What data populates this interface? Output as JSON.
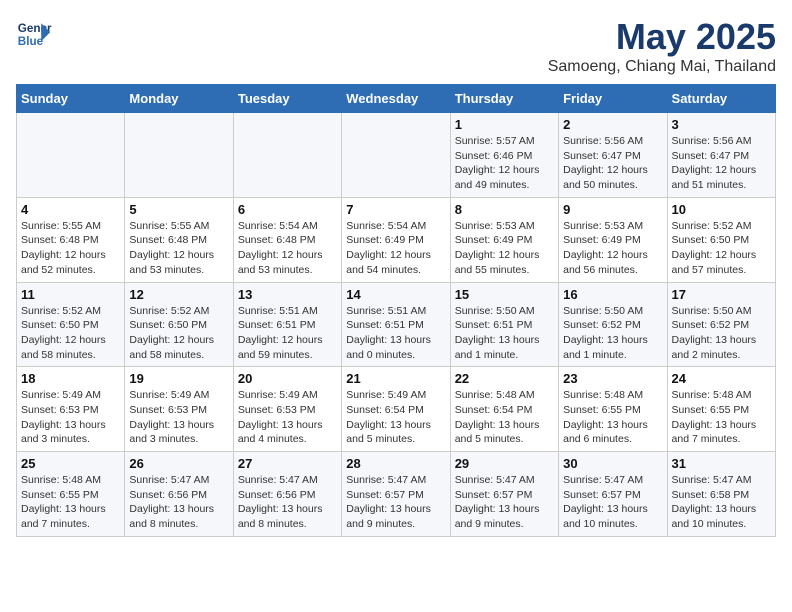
{
  "header": {
    "logo_line1": "General",
    "logo_line2": "Blue",
    "title": "May 2025",
    "subtitle": "Samoeng, Chiang Mai, Thailand"
  },
  "weekdays": [
    "Sunday",
    "Monday",
    "Tuesday",
    "Wednesday",
    "Thursday",
    "Friday",
    "Saturday"
  ],
  "weeks": [
    [
      {
        "day": "",
        "info": ""
      },
      {
        "day": "",
        "info": ""
      },
      {
        "day": "",
        "info": ""
      },
      {
        "day": "",
        "info": ""
      },
      {
        "day": "1",
        "info": "Sunrise: 5:57 AM\nSunset: 6:46 PM\nDaylight: 12 hours\nand 49 minutes."
      },
      {
        "day": "2",
        "info": "Sunrise: 5:56 AM\nSunset: 6:47 PM\nDaylight: 12 hours\nand 50 minutes."
      },
      {
        "day": "3",
        "info": "Sunrise: 5:56 AM\nSunset: 6:47 PM\nDaylight: 12 hours\nand 51 minutes."
      }
    ],
    [
      {
        "day": "4",
        "info": "Sunrise: 5:55 AM\nSunset: 6:48 PM\nDaylight: 12 hours\nand 52 minutes."
      },
      {
        "day": "5",
        "info": "Sunrise: 5:55 AM\nSunset: 6:48 PM\nDaylight: 12 hours\nand 53 minutes."
      },
      {
        "day": "6",
        "info": "Sunrise: 5:54 AM\nSunset: 6:48 PM\nDaylight: 12 hours\nand 53 minutes."
      },
      {
        "day": "7",
        "info": "Sunrise: 5:54 AM\nSunset: 6:49 PM\nDaylight: 12 hours\nand 54 minutes."
      },
      {
        "day": "8",
        "info": "Sunrise: 5:53 AM\nSunset: 6:49 PM\nDaylight: 12 hours\nand 55 minutes."
      },
      {
        "day": "9",
        "info": "Sunrise: 5:53 AM\nSunset: 6:49 PM\nDaylight: 12 hours\nand 56 minutes."
      },
      {
        "day": "10",
        "info": "Sunrise: 5:52 AM\nSunset: 6:50 PM\nDaylight: 12 hours\nand 57 minutes."
      }
    ],
    [
      {
        "day": "11",
        "info": "Sunrise: 5:52 AM\nSunset: 6:50 PM\nDaylight: 12 hours\nand 58 minutes."
      },
      {
        "day": "12",
        "info": "Sunrise: 5:52 AM\nSunset: 6:50 PM\nDaylight: 12 hours\nand 58 minutes."
      },
      {
        "day": "13",
        "info": "Sunrise: 5:51 AM\nSunset: 6:51 PM\nDaylight: 12 hours\nand 59 minutes."
      },
      {
        "day": "14",
        "info": "Sunrise: 5:51 AM\nSunset: 6:51 PM\nDaylight: 13 hours\nand 0 minutes."
      },
      {
        "day": "15",
        "info": "Sunrise: 5:50 AM\nSunset: 6:51 PM\nDaylight: 13 hours\nand 1 minute."
      },
      {
        "day": "16",
        "info": "Sunrise: 5:50 AM\nSunset: 6:52 PM\nDaylight: 13 hours\nand 1 minute."
      },
      {
        "day": "17",
        "info": "Sunrise: 5:50 AM\nSunset: 6:52 PM\nDaylight: 13 hours\nand 2 minutes."
      }
    ],
    [
      {
        "day": "18",
        "info": "Sunrise: 5:49 AM\nSunset: 6:53 PM\nDaylight: 13 hours\nand 3 minutes."
      },
      {
        "day": "19",
        "info": "Sunrise: 5:49 AM\nSunset: 6:53 PM\nDaylight: 13 hours\nand 3 minutes."
      },
      {
        "day": "20",
        "info": "Sunrise: 5:49 AM\nSunset: 6:53 PM\nDaylight: 13 hours\nand 4 minutes."
      },
      {
        "day": "21",
        "info": "Sunrise: 5:49 AM\nSunset: 6:54 PM\nDaylight: 13 hours\nand 5 minutes."
      },
      {
        "day": "22",
        "info": "Sunrise: 5:48 AM\nSunset: 6:54 PM\nDaylight: 13 hours\nand 5 minutes."
      },
      {
        "day": "23",
        "info": "Sunrise: 5:48 AM\nSunset: 6:55 PM\nDaylight: 13 hours\nand 6 minutes."
      },
      {
        "day": "24",
        "info": "Sunrise: 5:48 AM\nSunset: 6:55 PM\nDaylight: 13 hours\nand 7 minutes."
      }
    ],
    [
      {
        "day": "25",
        "info": "Sunrise: 5:48 AM\nSunset: 6:55 PM\nDaylight: 13 hours\nand 7 minutes."
      },
      {
        "day": "26",
        "info": "Sunrise: 5:47 AM\nSunset: 6:56 PM\nDaylight: 13 hours\nand 8 minutes."
      },
      {
        "day": "27",
        "info": "Sunrise: 5:47 AM\nSunset: 6:56 PM\nDaylight: 13 hours\nand 8 minutes."
      },
      {
        "day": "28",
        "info": "Sunrise: 5:47 AM\nSunset: 6:57 PM\nDaylight: 13 hours\nand 9 minutes."
      },
      {
        "day": "29",
        "info": "Sunrise: 5:47 AM\nSunset: 6:57 PM\nDaylight: 13 hours\nand 9 minutes."
      },
      {
        "day": "30",
        "info": "Sunrise: 5:47 AM\nSunset: 6:57 PM\nDaylight: 13 hours\nand 10 minutes."
      },
      {
        "day": "31",
        "info": "Sunrise: 5:47 AM\nSunset: 6:58 PM\nDaylight: 13 hours\nand 10 minutes."
      }
    ]
  ]
}
